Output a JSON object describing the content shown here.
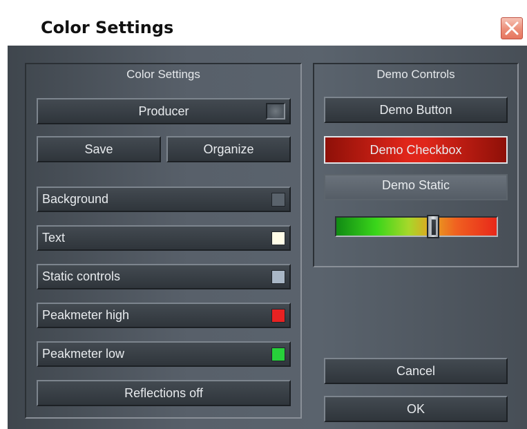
{
  "window": {
    "title": "Color Settings"
  },
  "left_panel": {
    "title": "Color Settings",
    "profile_button": "Producer",
    "save_button": "Save",
    "organize_button": "Organize",
    "color_items": [
      {
        "label": "Background",
        "color": "#5a636c"
      },
      {
        "label": "Text",
        "color": "#fffde8"
      },
      {
        "label": "Static controls",
        "color": "#a9b7c6"
      },
      {
        "label": "Peakmeter high",
        "color": "#e82222"
      },
      {
        "label": "Peakmeter low",
        "color": "#27d13a"
      }
    ],
    "reflections_button": "Reflections off"
  },
  "right_panel": {
    "title": "Demo Controls",
    "demo_button": "Demo Button",
    "demo_checkbox": "Demo Checkbox",
    "demo_static": "Demo Static",
    "slider_position": 0.6
  },
  "buttons": {
    "cancel": "Cancel",
    "ok": "OK"
  }
}
